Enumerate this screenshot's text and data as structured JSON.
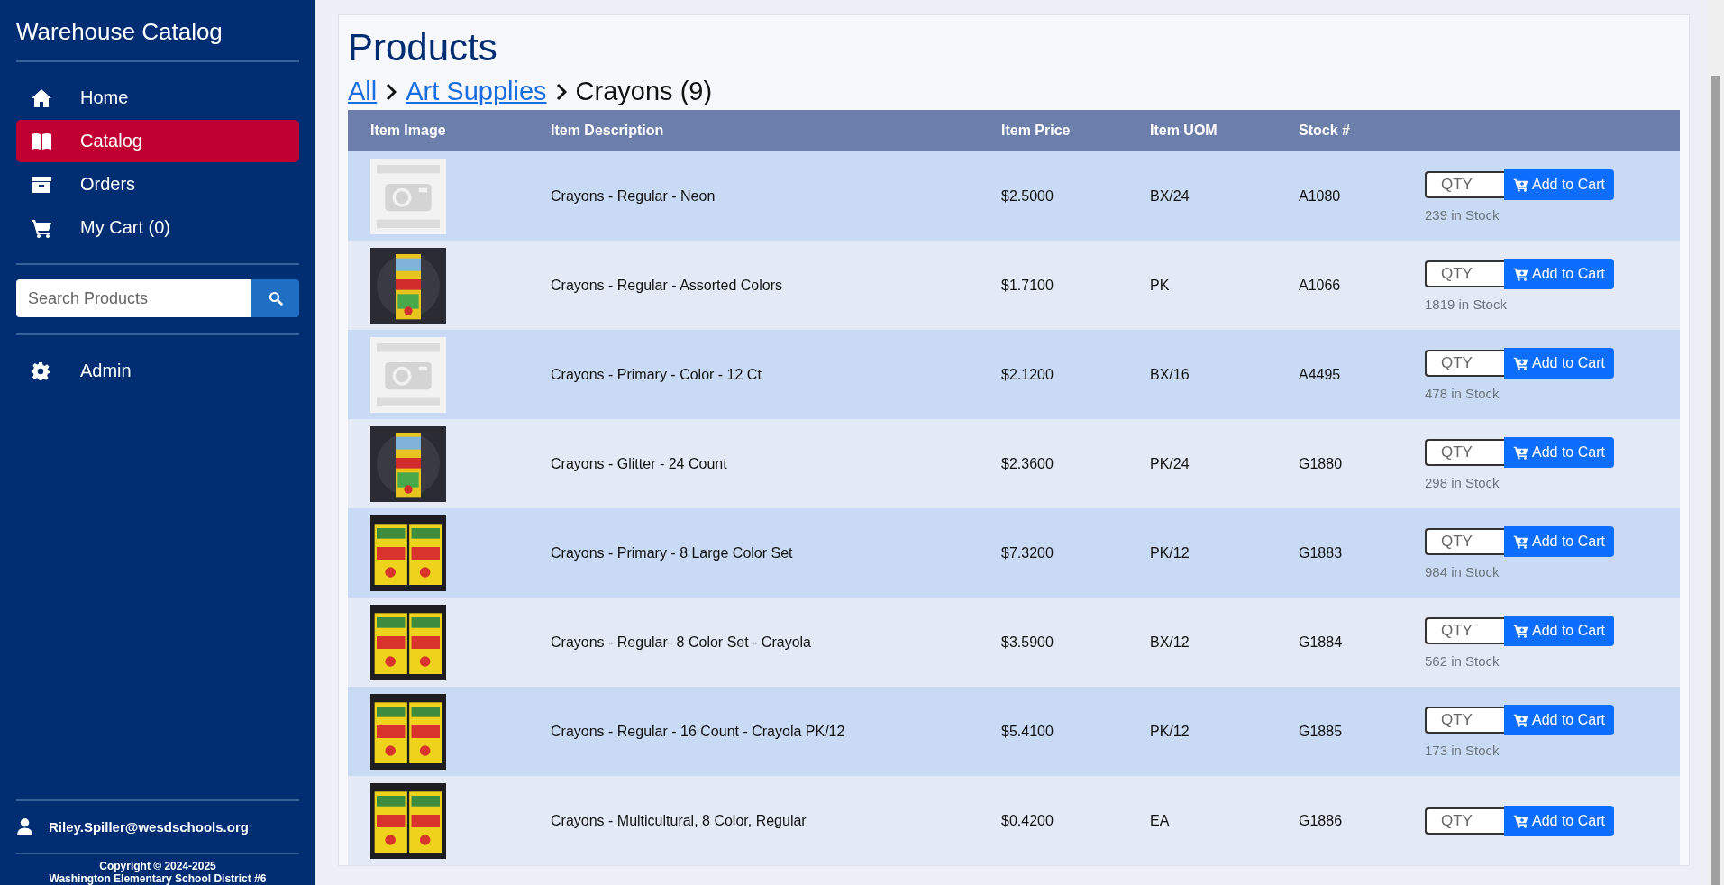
{
  "sidebar": {
    "title": "Warehouse Catalog",
    "nav": [
      {
        "label": "Home",
        "selected": false
      },
      {
        "label": "Catalog",
        "selected": true
      },
      {
        "label": "Orders",
        "selected": false
      },
      {
        "label": "My Cart (0)",
        "selected": false
      }
    ],
    "search": {
      "placeholder": "Search Products"
    },
    "admin": {
      "label": "Admin",
      "selected": false
    },
    "user": "Riley.Spiller@wesdschools.org",
    "copyright": [
      "Copyright © 2024-2025",
      "Washington Elementary School District #6"
    ]
  },
  "page": {
    "title": "Products",
    "breadcrumb": [
      {
        "label": "All",
        "link": true
      },
      {
        "label": "Art Supplies",
        "link": true
      },
      {
        "label": "Crayons (9)",
        "link": false
      }
    ]
  },
  "table": {
    "columns": [
      "Item Image",
      "Item Description",
      "Item Price",
      "Item UOM",
      "Stock #"
    ],
    "rows": [
      {
        "image": {
          "kind": "placeholder"
        },
        "description": "Crayons - Regular - Neon",
        "price": "$2.5000",
        "uom": "BX/24",
        "stock_no": "A1080",
        "qty_placeholder": "QTY",
        "button": "Add to Cart",
        "in_stock": "239 in Stock"
      },
      {
        "image": {
          "kind": "single-box"
        },
        "description": "Crayons - Regular - Assorted Colors",
        "price": "$1.7100",
        "uom": "PK",
        "stock_no": "A1066",
        "qty_placeholder": "QTY",
        "button": "Add to Cart",
        "in_stock": "1819 in Stock"
      },
      {
        "image": {
          "kind": "placeholder"
        },
        "description": "Crayons - Primary - Color - 12 Ct",
        "price": "$2.1200",
        "uom": "BX/16",
        "stock_no": "A4495",
        "qty_placeholder": "QTY",
        "button": "Add to Cart",
        "in_stock": "478 in Stock"
      },
      {
        "image": {
          "kind": "single-box"
        },
        "description": "Crayons - Glitter - 24 Count",
        "price": "$2.3600",
        "uom": "PK/24",
        "stock_no": "G1880",
        "qty_placeholder": "QTY",
        "button": "Add to Cart",
        "in_stock": "298 in Stock"
      },
      {
        "image": {
          "kind": "double-box"
        },
        "description": "Crayons - Primary - 8 Large Color Set",
        "price": "$7.3200",
        "uom": "PK/12",
        "stock_no": "G1883",
        "qty_placeholder": "QTY",
        "button": "Add to Cart",
        "in_stock": "984 in Stock"
      },
      {
        "image": {
          "kind": "double-box"
        },
        "description": "Crayons - Regular- 8 Color Set - Crayola",
        "price": "$3.5900",
        "uom": "BX/12",
        "stock_no": "G1884",
        "qty_placeholder": "QTY",
        "button": "Add to Cart",
        "in_stock": "562 in Stock"
      },
      {
        "image": {
          "kind": "double-box"
        },
        "description": "Crayons - Regular - 16 Count - Crayola PK/12",
        "price": "$5.4100",
        "uom": "PK/12",
        "stock_no": "G1885",
        "qty_placeholder": "QTY",
        "button": "Add to Cart",
        "in_stock": "173 in Stock"
      },
      {
        "image": {
          "kind": "double-box"
        },
        "description": "Crayons - Multicultural, 8 Color, Regular",
        "price": "$0.4200",
        "uom": "EA",
        "stock_no": "G1886",
        "qty_placeholder": "QTY",
        "button": "Add to Cart"
      }
    ]
  }
}
